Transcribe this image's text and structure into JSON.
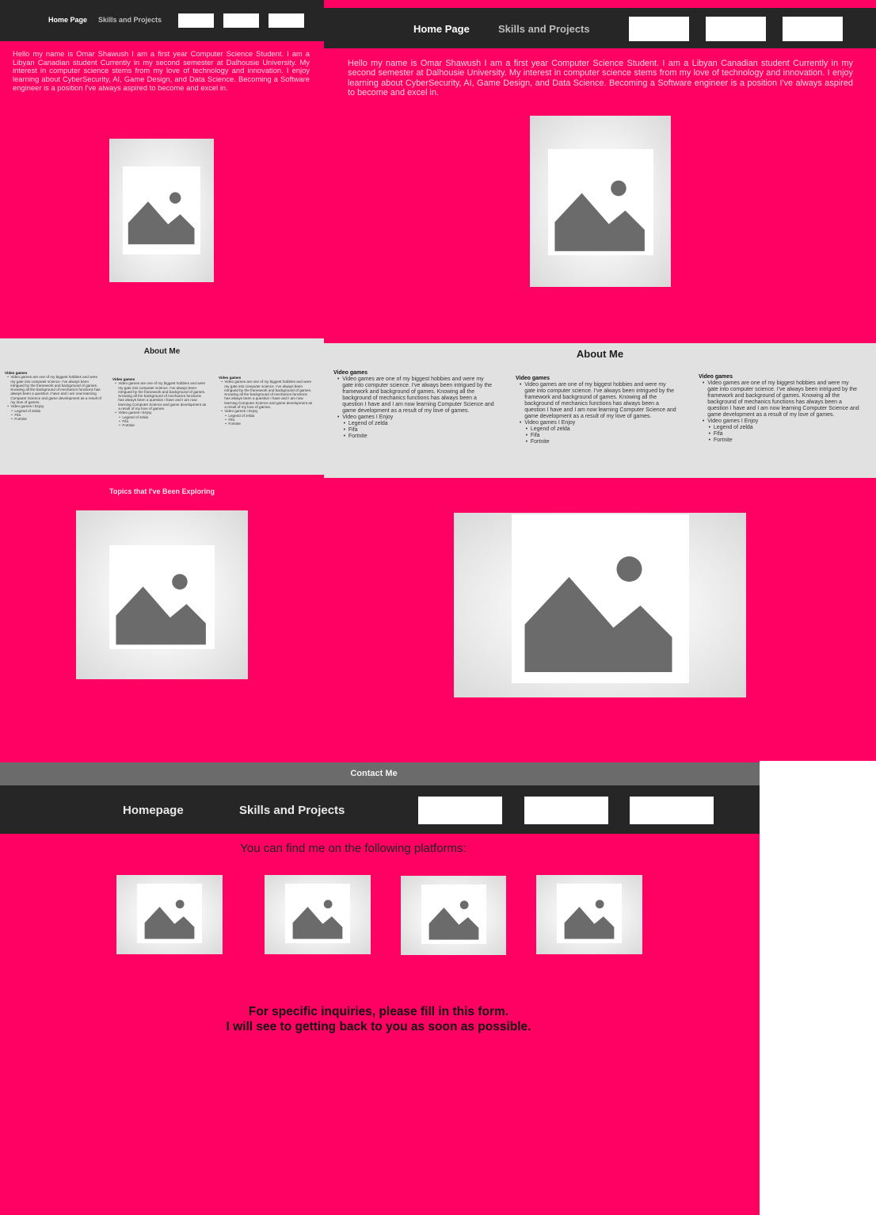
{
  "screen1": {
    "nav": {
      "home": "Home Page",
      "skills": "Skills and Projects"
    },
    "intro": "Hello my name is Omar Shawush I am a first year Computer Science Student. I am a Libyan Canadian student Currently in my second semester at Dalhousie University. My interest in computer science stems from my love of technology and innovation. I enjoy learning about CyberSecurity, AI, Game Design, and Data Science. Becoming a Software engineer is a position I've always aspired to become and excel in.",
    "hero_image_icon": "image-placeholder-icon",
    "about": {
      "title": "About Me",
      "columns": [
        {
          "heading": "Video games",
          "text": "Video games are one of my biggest hobbies and were my gate into computer science. I've always been intrigued by the framework and background of games. Knowing all the background of mechanics functions has always been a question I have and I am now learning Computer Science and game development as a result of my love of games.",
          "enjoy": "Video games I Enjoy",
          "games": [
            "Legend of zelda",
            "Fifa",
            "Fortnite"
          ]
        },
        {
          "heading": "Video games",
          "text": "Video games are one of my biggest hobbies and were my gate into computer science. I've always been intrigued by the framework and background of games. Knowing all the background of mechanics functions has always been a question I have and I am now learning Computer Science and game development as a result of my love of games.",
          "enjoy": "Video games I Enjoy",
          "games": [
            "Legend of zelda",
            "Fifa",
            "Fortnite"
          ]
        },
        {
          "heading": "Video games",
          "text": "Video games are one of my biggest hobbies and were my gate into computer science. I've always been intrigued by the framework and background of games. Knowing all the background of mechanics functions has always been a question I have and I am now learning Computer Science and game development as a result of my love of games.",
          "enjoy": "Video games I Enjoy",
          "games": [
            "Legend of zelda",
            "Fifa",
            "Fortnite"
          ]
        }
      ]
    },
    "topics_title": "Topics that I've Been Exploring"
  },
  "screen2": {
    "nav": {
      "home": "Home Page",
      "skills": "Skills and Projects"
    },
    "intro": "Hello my name is Omar Shawush I am a first year Computer Science Student. I am a Libyan Canadian student Currently in my second semester at Dalhousie University. My interest in computer science stems from my love of technology and innovation. I enjoy learning about CyberSecurity, AI, Game Design, and Data Science. Becoming a Software engineer is a position I've always aspired to become and excel in.",
    "about": {
      "title": "About Me",
      "columns": [
        {
          "heading": "Video games",
          "text": "Video games are one of my biggest hobbies and were my gate into computer science. I've always been intrigued by the framework and background of games. Knowing all the background of mechanics functions has always been a question I have and I am now learning Computer Science and game development as a result of my love of games.",
          "enjoy": "Video games I Enjoy",
          "games": [
            "Legend of zelda",
            "Fifa",
            "Fortnite"
          ]
        },
        {
          "heading": "Video games",
          "text": "Video games are one of my biggest hobbies and were my gate into computer science. I've always been intrigued by the framework and background of games. Knowing all the background of mechanics functions has always been a question I have and I am now learning Computer Science and game development as a result of my love of games.",
          "enjoy": "Video games I Enjoy",
          "games": [
            "Legend of zelda",
            "Fifa",
            "Fortnite"
          ]
        },
        {
          "heading": "Video games",
          "text": "Video games are one of my biggest hobbies and were my gate into computer science. I've always been intrigued by the framework and background of games. Knowing all the background of mechanics functions has always been a question I have and I am now learning Computer Science and game development as a result of my love of games.",
          "enjoy": "Video games I Enjoy",
          "games": [
            "Legend of zelda",
            "Fifa",
            "Fortnite"
          ]
        }
      ]
    }
  },
  "contact": {
    "title": "Contact Me",
    "nav": {
      "home": "Homepage",
      "skills": "Skills and Projects"
    },
    "platforms_text": "You can find me on the following platforms:",
    "inquiry_line1": "For specific inquiries, please fill in this form.",
    "inquiry_line2": "I will see to getting back to you as soon as possible."
  },
  "colors": {
    "accent_pink": "#ff0063",
    "nav_dark": "#262626",
    "about_gray": "#e1e1e1",
    "contact_bar": "#6b6b6b"
  }
}
